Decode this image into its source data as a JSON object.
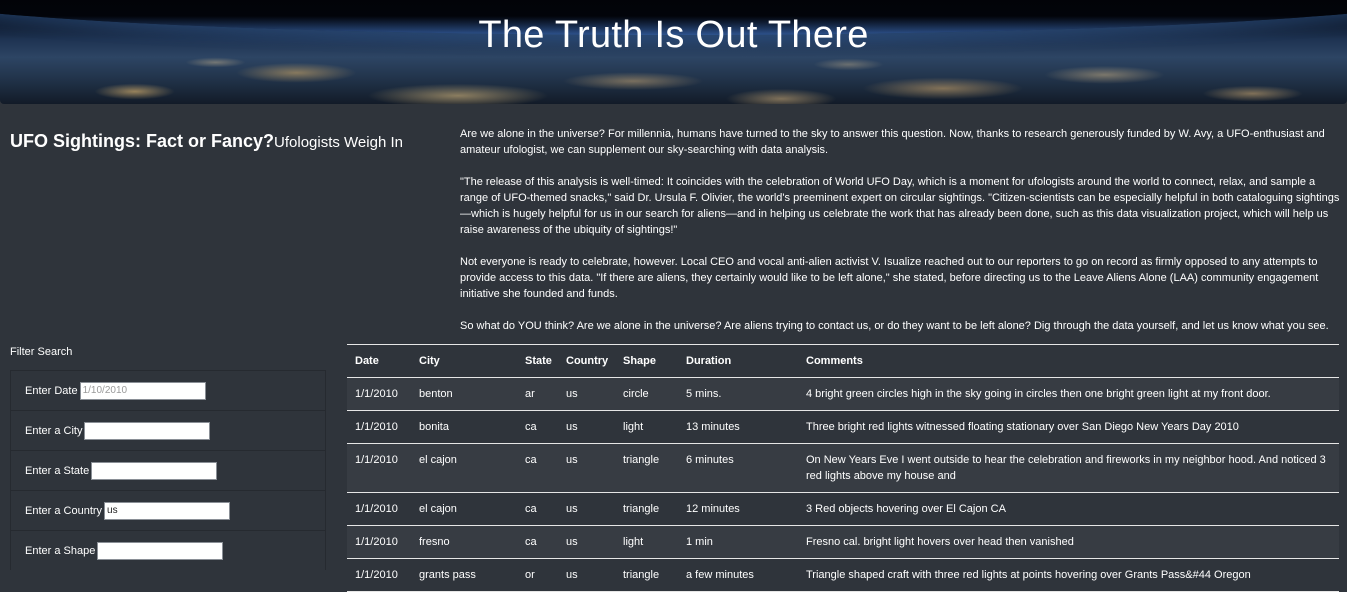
{
  "hero": {
    "title": "The Truth Is Out There"
  },
  "headline": {
    "main": "UFO Sightings: Fact or Fancy?",
    "sub": "Ufologists Weigh In"
  },
  "article": {
    "paragraphs": [
      "Are we alone in the universe? For millennia, humans have turned to the sky to answer this question. Now, thanks to research generously funded by W. Avy, a UFO-enthusiast and amateur ufologist, we can supplement our sky-searching with data analysis.",
      "\"The release of this analysis is well-timed: It coincides with the celebration of World UFO Day, which is a moment for ufologists around the world to connect, relax, and sample a range of UFO-themed snacks,\" said Dr. Ursula F. Olivier, the world's preeminent expert on circular sightings. \"Citizen-scientists can be especially helpful in both cataloguing sightings—which is hugely helpful for us in our search for aliens—and in helping us celebrate the work that has already been done, such as this data visualization project, which will help us raise awareness of the ubiquity of sightings!\"",
      "Not everyone is ready to celebrate, however. Local CEO and vocal anti-alien activist V. Isualize reached out to our reporters to go on record as firmly opposed to any attempts to provide access to this data. \"If there are aliens, they certainly would like to be left alone,\" she stated, before directing us to the Leave Aliens Alone (LAA) community engagement initiative she founded and funds.",
      "So what do YOU think? Are we alone in the universe? Are aliens trying to contact us, or do they want to be left alone? Dig through the data yourself, and let us know what you see."
    ]
  },
  "filters": {
    "title": "Filter Search",
    "date": {
      "label": "Enter Date",
      "value": "",
      "placeholder": "1/10/2010"
    },
    "city": {
      "label": "Enter a City",
      "value": "",
      "placeholder": ""
    },
    "state": {
      "label": "Enter a State",
      "value": "",
      "placeholder": ""
    },
    "country": {
      "label": "Enter a Country",
      "value": "us",
      "placeholder": ""
    },
    "shape": {
      "label": "Enter a Shape",
      "value": "",
      "placeholder": ""
    }
  },
  "table": {
    "headers": [
      "Date",
      "City",
      "State",
      "Country",
      "Shape",
      "Duration",
      "Comments"
    ],
    "rows": [
      [
        "1/1/2010",
        "benton",
        "ar",
        "us",
        "circle",
        "5 mins.",
        "4 bright green circles high in the sky going in circles then one bright green light at my front door."
      ],
      [
        "1/1/2010",
        "bonita",
        "ca",
        "us",
        "light",
        "13 minutes",
        "Three bright red lights witnessed floating stationary over San Diego New Years Day 2010"
      ],
      [
        "1/1/2010",
        "el cajon",
        "ca",
        "us",
        "triangle",
        "6 minutes",
        "On New Years Eve I went outside to hear the celebration and fireworks in my neighbor hood. And noticed 3 red lights above my house and"
      ],
      [
        "1/1/2010",
        "el cajon",
        "ca",
        "us",
        "triangle",
        "12 minutes",
        "3 Red objects hovering over El Cajon CA"
      ],
      [
        "1/1/2010",
        "fresno",
        "ca",
        "us",
        "light",
        "1 min",
        "Fresno cal. bright light hovers over head then vanished"
      ],
      [
        "1/1/2010",
        "grants pass",
        "or",
        "us",
        "triangle",
        "a few minutes",
        "Triangle shaped craft with three red lights at points hovering over Grants Pass&#44 Oregon"
      ]
    ]
  }
}
